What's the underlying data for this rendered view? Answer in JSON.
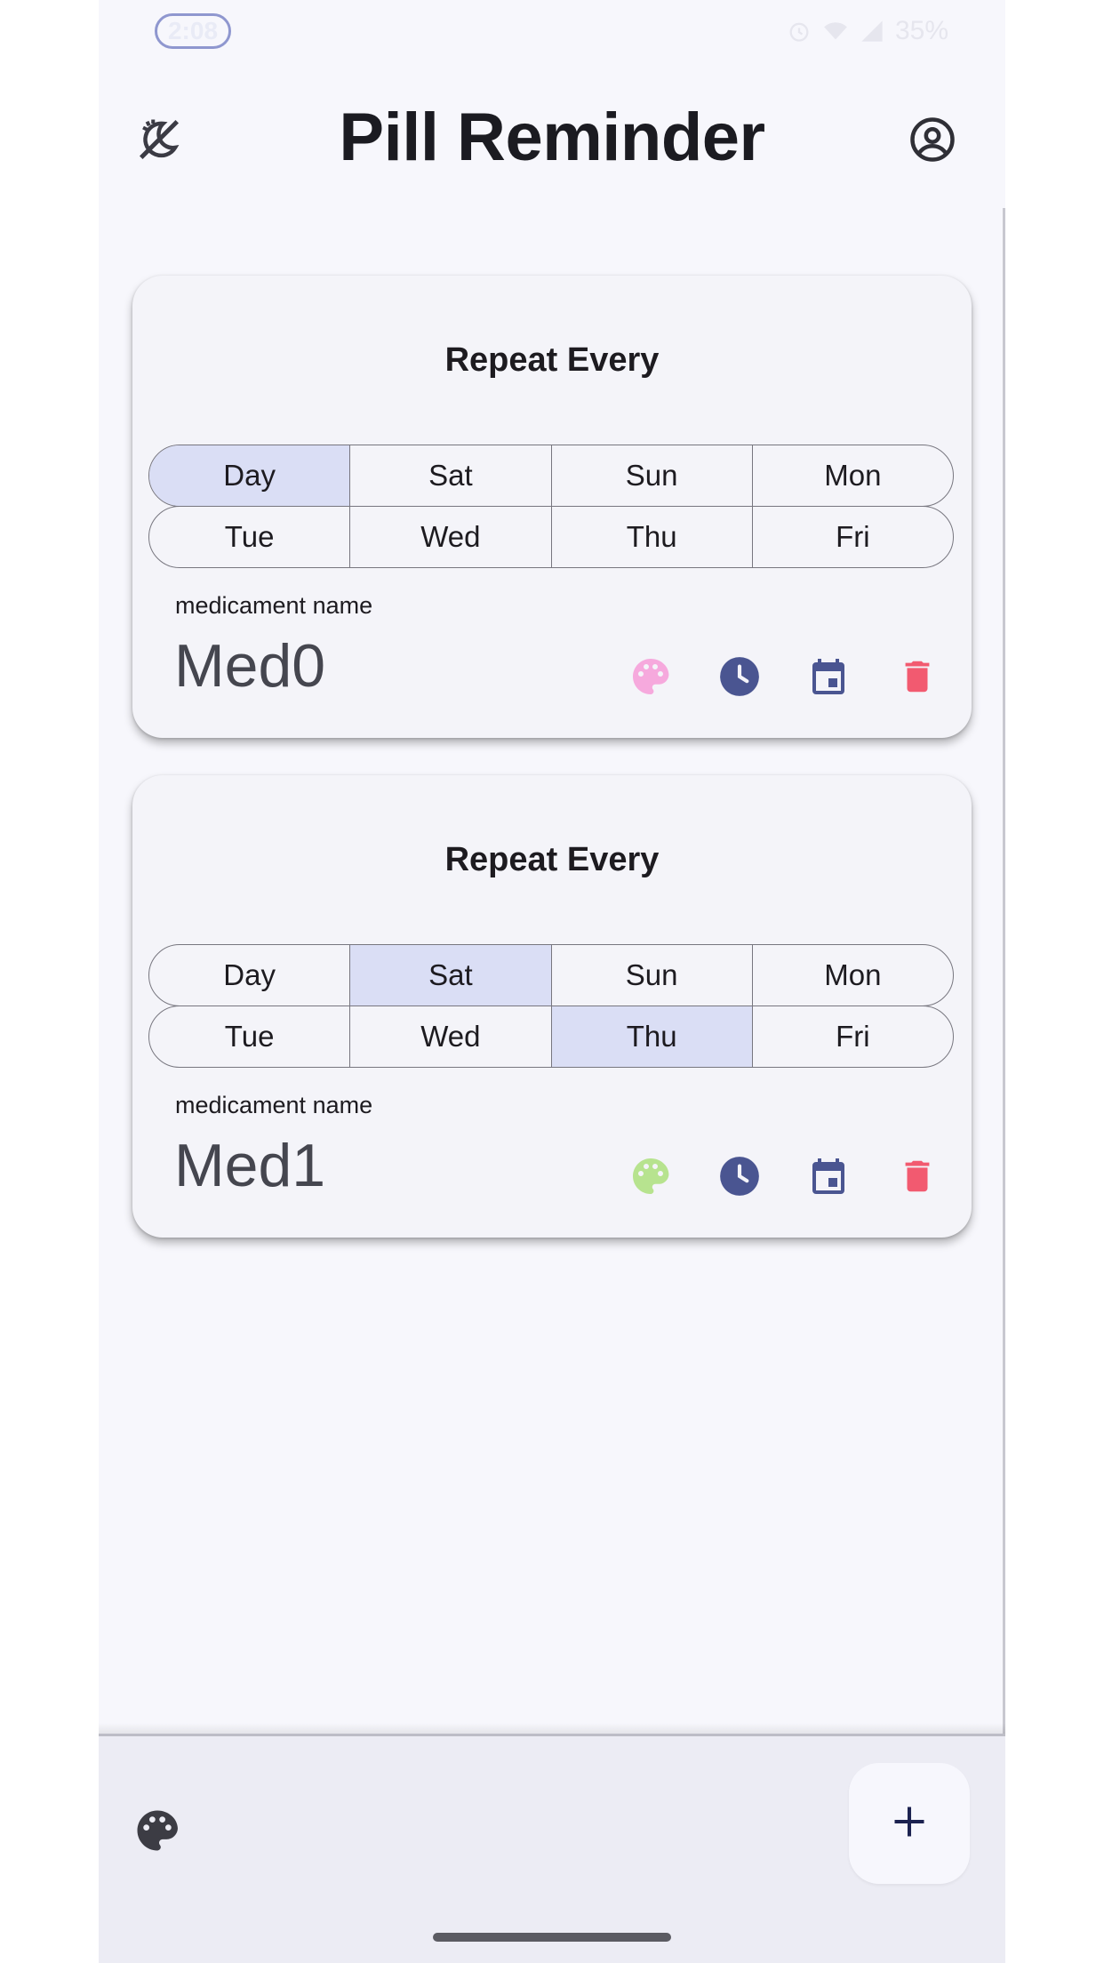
{
  "status_bar": {
    "time": "2:08",
    "battery": "35%"
  },
  "app_bar": {
    "title": "Pill Reminder",
    "left_icon": "theme-toggle-icon",
    "right_icon": "account-circle-icon"
  },
  "cards": [
    {
      "title": "Repeat Every",
      "days_row1": [
        "Day",
        "Sat",
        "Sun",
        "Mon"
      ],
      "days_row2": [
        "Tue",
        "Wed",
        "Thu",
        "Fri"
      ],
      "selected": [
        "Day"
      ],
      "name_label": "medicament name",
      "name": "Med0",
      "palette_color": "#f6a9dd"
    },
    {
      "title": "Repeat Every",
      "days_row1": [
        "Day",
        "Sat",
        "Sun",
        "Mon"
      ],
      "days_row2": [
        "Tue",
        "Wed",
        "Thu",
        "Fri"
      ],
      "selected": [
        "Sat",
        "Thu"
      ],
      "name_label": "medicament name",
      "name": "Med1",
      "palette_color": "#b7e38f"
    }
  ],
  "colors": {
    "accent": "#4a5591",
    "delete": "#f25a70",
    "selected_day": "#dadef5"
  },
  "bottom_bar": {
    "fab_label": "+"
  }
}
